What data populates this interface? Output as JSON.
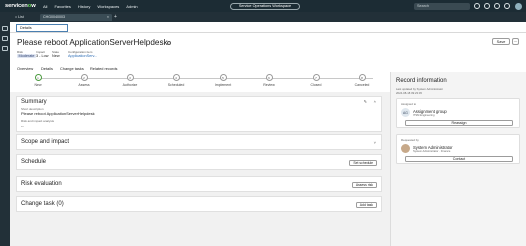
{
  "nav": {
    "logo_a": "servicen",
    "logo_o": "o",
    "logo_b": "w",
    "links": [
      "All",
      "Favorites",
      "History",
      "Workspaces",
      "Admin"
    ],
    "workspace": "Service Operations Workspace",
    "search_placeholder": "Search"
  },
  "tabs": {
    "list": "List",
    "record": "CHG0040003"
  },
  "details_field": "Details",
  "record": {
    "title": "Please reboot ApplicationServerHelpdesk",
    "save_label": "Save",
    "more_label": "⋯",
    "meta": [
      {
        "label": "Risk",
        "value": "Moderate"
      },
      {
        "label": "Impact",
        "value": "3 - Low"
      },
      {
        "label": "State",
        "value": "New"
      },
      {
        "label": "Configuration item",
        "value": "ApplicationServ..."
      }
    ],
    "subtabs": [
      "Overview",
      "Details",
      "Change tasks",
      "Related records"
    ]
  },
  "stages": [
    {
      "num": "1",
      "label": "New"
    },
    {
      "num": "2",
      "label": "Assess"
    },
    {
      "num": "3",
      "label": "Authorize"
    },
    {
      "num": "4",
      "label": "Scheduled"
    },
    {
      "num": "5",
      "label": "Implement"
    },
    {
      "num": "6",
      "label": "Review"
    },
    {
      "num": "7",
      "label": "Closed"
    },
    {
      "num": "8",
      "label": "Canceled"
    }
  ],
  "summary": {
    "title": "Summary",
    "short_desc_label": "Short description",
    "short_desc": "Please reboot ApplicationServerHelpdesk",
    "risk_label": "Risk and impact analysis",
    "risk_value": "--"
  },
  "sections": {
    "scope": "Scope and impact",
    "schedule": "Schedule",
    "schedule_btn": "Set schedule",
    "risk": "Risk evaluation",
    "risk_btn": "Assess risk",
    "change_task": "Change task (0)",
    "change_task_btn": "Add task"
  },
  "side": {
    "title": "Record information",
    "updated": "Last updated by System Administrator",
    "updated_date": "2024-08-18 09:23:45",
    "assigned_label": "Assigned to",
    "group_initials": "AG",
    "group_name": "Assignment group",
    "group_sub": "ITSM Engineering",
    "reassign": "Reassign",
    "requested_label": "Requested by",
    "requester_name": "System Administrator",
    "requester_sub": "System Administrator · Finance",
    "contact": "Contact"
  }
}
